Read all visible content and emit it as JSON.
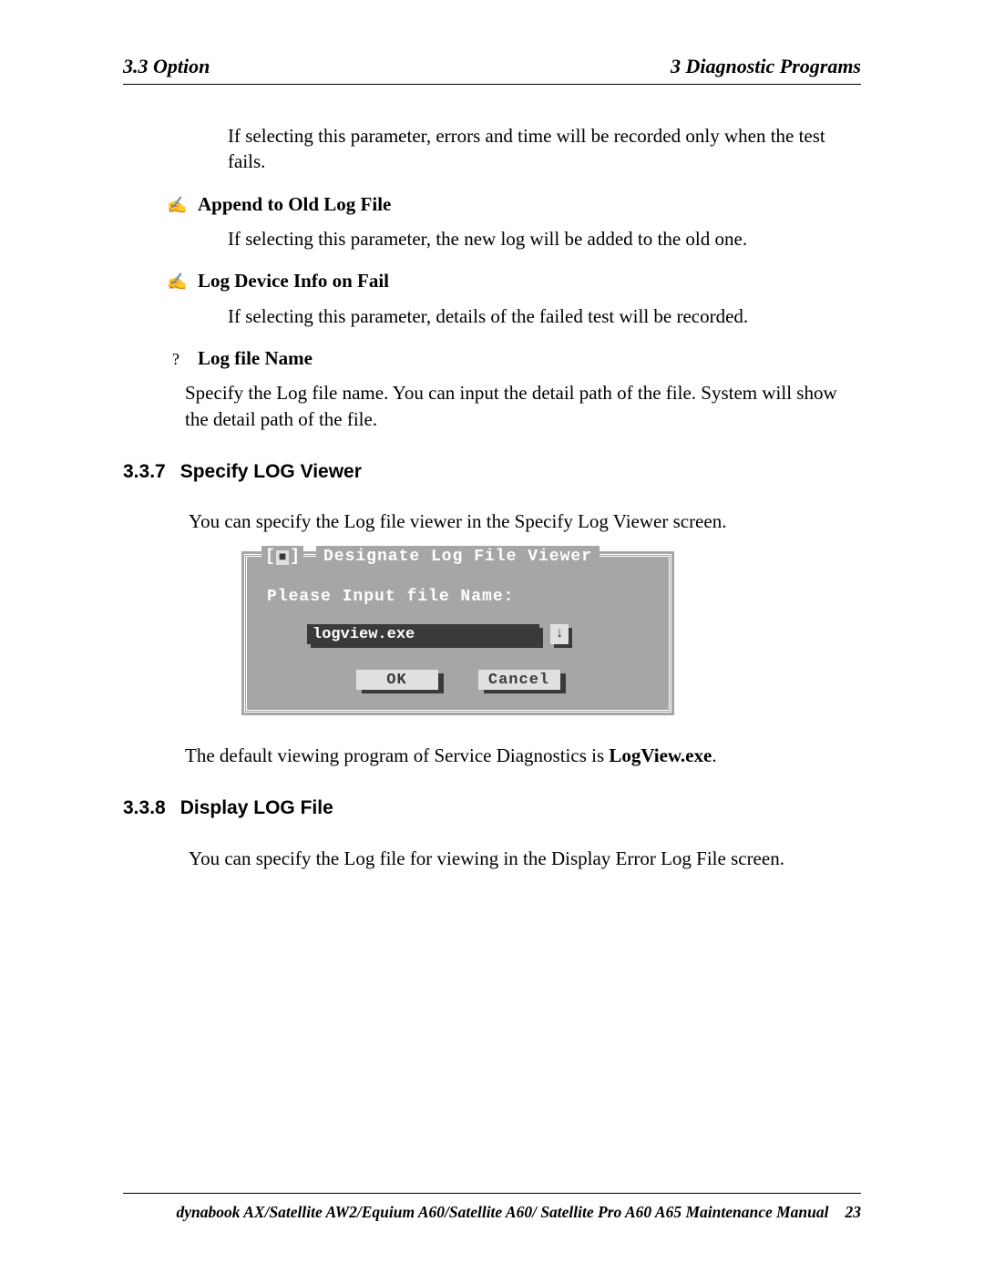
{
  "header": {
    "left": "3.3 Option",
    "right": "3  Diagnostic Programs"
  },
  "intro_para": "If selecting this parameter, errors and time will be recorded only when the test fails.",
  "bullets": [
    {
      "icon": "✍",
      "title": "Append to Old Log File",
      "body": "If selecting this parameter, the new log will be added to the old one."
    },
    {
      "icon": "✍",
      "title": "Log Device Info on Fail",
      "body": "If selecting this parameter, details of the failed test will be recorded."
    },
    {
      "icon": "?",
      "title": "Log file Name",
      "body": "Specify the Log file name. You can input the detail path of the file. System will show the detail path of the file."
    }
  ],
  "section337": {
    "num": "3.3.7",
    "title": "Specify LOG Viewer",
    "intro": "You can specify the Log file viewer in the Specify Log Viewer screen.",
    "default_pre": "The default viewing program of Service Diagnostics is ",
    "default_bold": "LogView.exe",
    "default_post": "."
  },
  "dialog": {
    "close_glyph": "■",
    "title": "Designate Log File Viewer",
    "prompt": "Please Input file Name:",
    "input_value": "logview.exe",
    "arrow": "↓",
    "ok": "OK",
    "cancel": "Cancel"
  },
  "section338": {
    "num": "3.3.8",
    "title": "Display LOG File",
    "intro": "You can specify the Log file for viewing in the Display Error Log File screen."
  },
  "footer": {
    "text": "dynabook AX/Satellite AW2/Equium A60/Satellite A60/ Satellite Pro A60 A65  Maintenance Manual",
    "page": "23"
  }
}
